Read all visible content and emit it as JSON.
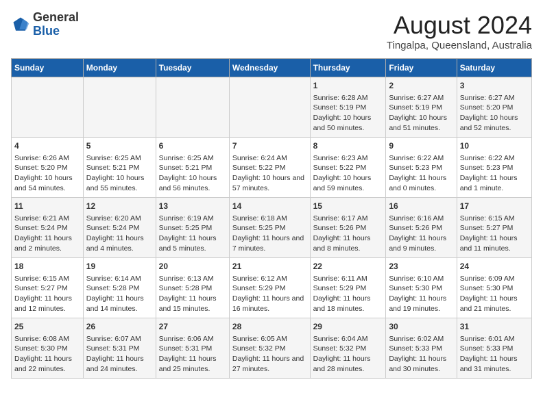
{
  "header": {
    "logo": {
      "general": "General",
      "blue": "Blue"
    },
    "title": "August 2024",
    "subtitle": "Tingalpa, Queensland, Australia"
  },
  "weekdays": [
    "Sunday",
    "Monday",
    "Tuesday",
    "Wednesday",
    "Thursday",
    "Friday",
    "Saturday"
  ],
  "weeks": [
    [
      {
        "day": "",
        "info": ""
      },
      {
        "day": "",
        "info": ""
      },
      {
        "day": "",
        "info": ""
      },
      {
        "day": "",
        "info": ""
      },
      {
        "day": "1",
        "info": "Sunrise: 6:28 AM\nSunset: 5:19 PM\nDaylight: 10 hours and 50 minutes."
      },
      {
        "day": "2",
        "info": "Sunrise: 6:27 AM\nSunset: 5:19 PM\nDaylight: 10 hours and 51 minutes."
      },
      {
        "day": "3",
        "info": "Sunrise: 6:27 AM\nSunset: 5:20 PM\nDaylight: 10 hours and 52 minutes."
      }
    ],
    [
      {
        "day": "4",
        "info": "Sunrise: 6:26 AM\nSunset: 5:20 PM\nDaylight: 10 hours and 54 minutes."
      },
      {
        "day": "5",
        "info": "Sunrise: 6:25 AM\nSunset: 5:21 PM\nDaylight: 10 hours and 55 minutes."
      },
      {
        "day": "6",
        "info": "Sunrise: 6:25 AM\nSunset: 5:21 PM\nDaylight: 10 hours and 56 minutes."
      },
      {
        "day": "7",
        "info": "Sunrise: 6:24 AM\nSunset: 5:22 PM\nDaylight: 10 hours and 57 minutes."
      },
      {
        "day": "8",
        "info": "Sunrise: 6:23 AM\nSunset: 5:22 PM\nDaylight: 10 hours and 59 minutes."
      },
      {
        "day": "9",
        "info": "Sunrise: 6:22 AM\nSunset: 5:23 PM\nDaylight: 11 hours and 0 minutes."
      },
      {
        "day": "10",
        "info": "Sunrise: 6:22 AM\nSunset: 5:23 PM\nDaylight: 11 hours and 1 minute."
      }
    ],
    [
      {
        "day": "11",
        "info": "Sunrise: 6:21 AM\nSunset: 5:24 PM\nDaylight: 11 hours and 2 minutes."
      },
      {
        "day": "12",
        "info": "Sunrise: 6:20 AM\nSunset: 5:24 PM\nDaylight: 11 hours and 4 minutes."
      },
      {
        "day": "13",
        "info": "Sunrise: 6:19 AM\nSunset: 5:25 PM\nDaylight: 11 hours and 5 minutes."
      },
      {
        "day": "14",
        "info": "Sunrise: 6:18 AM\nSunset: 5:25 PM\nDaylight: 11 hours and 7 minutes."
      },
      {
        "day": "15",
        "info": "Sunrise: 6:17 AM\nSunset: 5:26 PM\nDaylight: 11 hours and 8 minutes."
      },
      {
        "day": "16",
        "info": "Sunrise: 6:16 AM\nSunset: 5:26 PM\nDaylight: 11 hours and 9 minutes."
      },
      {
        "day": "17",
        "info": "Sunrise: 6:15 AM\nSunset: 5:27 PM\nDaylight: 11 hours and 11 minutes."
      }
    ],
    [
      {
        "day": "18",
        "info": "Sunrise: 6:15 AM\nSunset: 5:27 PM\nDaylight: 11 hours and 12 minutes."
      },
      {
        "day": "19",
        "info": "Sunrise: 6:14 AM\nSunset: 5:28 PM\nDaylight: 11 hours and 14 minutes."
      },
      {
        "day": "20",
        "info": "Sunrise: 6:13 AM\nSunset: 5:28 PM\nDaylight: 11 hours and 15 minutes."
      },
      {
        "day": "21",
        "info": "Sunrise: 6:12 AM\nSunset: 5:29 PM\nDaylight: 11 hours and 16 minutes."
      },
      {
        "day": "22",
        "info": "Sunrise: 6:11 AM\nSunset: 5:29 PM\nDaylight: 11 hours and 18 minutes."
      },
      {
        "day": "23",
        "info": "Sunrise: 6:10 AM\nSunset: 5:30 PM\nDaylight: 11 hours and 19 minutes."
      },
      {
        "day": "24",
        "info": "Sunrise: 6:09 AM\nSunset: 5:30 PM\nDaylight: 11 hours and 21 minutes."
      }
    ],
    [
      {
        "day": "25",
        "info": "Sunrise: 6:08 AM\nSunset: 5:30 PM\nDaylight: 11 hours and 22 minutes."
      },
      {
        "day": "26",
        "info": "Sunrise: 6:07 AM\nSunset: 5:31 PM\nDaylight: 11 hours and 24 minutes."
      },
      {
        "day": "27",
        "info": "Sunrise: 6:06 AM\nSunset: 5:31 PM\nDaylight: 11 hours and 25 minutes."
      },
      {
        "day": "28",
        "info": "Sunrise: 6:05 AM\nSunset: 5:32 PM\nDaylight: 11 hours and 27 minutes."
      },
      {
        "day": "29",
        "info": "Sunrise: 6:04 AM\nSunset: 5:32 PM\nDaylight: 11 hours and 28 minutes."
      },
      {
        "day": "30",
        "info": "Sunrise: 6:02 AM\nSunset: 5:33 PM\nDaylight: 11 hours and 30 minutes."
      },
      {
        "day": "31",
        "info": "Sunrise: 6:01 AM\nSunset: 5:33 PM\nDaylight: 11 hours and 31 minutes."
      }
    ]
  ]
}
